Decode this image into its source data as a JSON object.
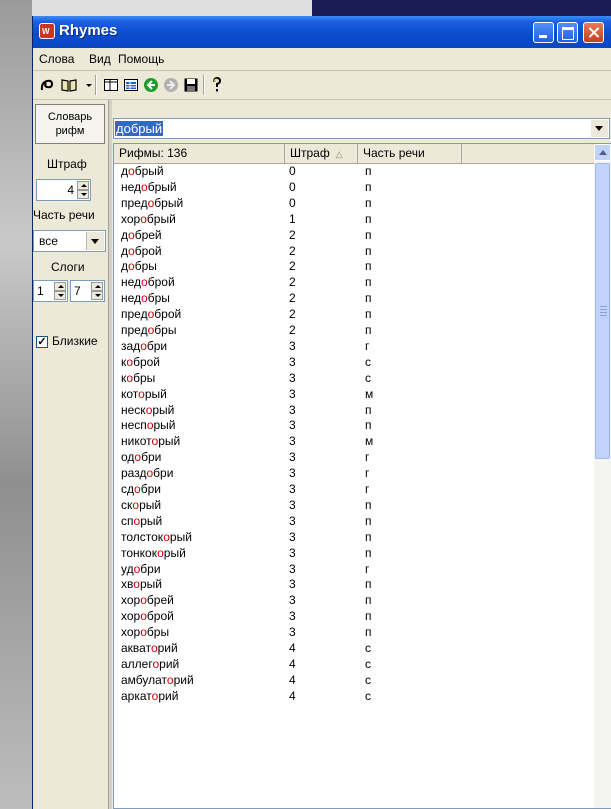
{
  "window": {
    "title": "Rhymes",
    "app_icon_text": "W"
  },
  "menu": {
    "items": [
      "Слова",
      "Вид",
      "Помощь"
    ]
  },
  "toolbar": {
    "icons": [
      "cursor-icon",
      "book-icon",
      "dropdown-arrow-icon",
      "layout-icon",
      "table-icon",
      "go-forward-icon",
      "go-disabled-icon",
      "save-icon",
      "help-icon"
    ]
  },
  "left_panel": {
    "dict_button": "Словарь рифм",
    "penalty_label": "Штраф",
    "penalty_value": "4",
    "pos_label": "Часть речи",
    "pos_value": "все",
    "syllables_label": "Слоги",
    "syl_from": "1",
    "syl_to": "7",
    "close_label": "Близкие",
    "close_checked": true
  },
  "search": {
    "word": "добрый"
  },
  "list": {
    "headers": {
      "rhymes": "Рифмы: 136",
      "penalty": "Штраф",
      "pos": "Часть речи"
    },
    "rows": [
      {
        "pre": "д",
        "hl": "о",
        "post": "брый",
        "penalty": "0",
        "pos": "п"
      },
      {
        "pre": "нед",
        "hl": "о",
        "post": "брый",
        "penalty": "0",
        "pos": "п"
      },
      {
        "pre": "пред",
        "hl": "о",
        "post": "брый",
        "penalty": "0",
        "pos": "п"
      },
      {
        "pre": "хор",
        "hl": "о",
        "post": "брый",
        "penalty": "1",
        "pos": "п"
      },
      {
        "pre": "д",
        "hl": "о",
        "post": "брей",
        "penalty": "2",
        "pos": "п"
      },
      {
        "pre": "д",
        "hl": "о",
        "post": "брой",
        "penalty": "2",
        "pos": "п"
      },
      {
        "pre": "д",
        "hl": "о",
        "post": "бры",
        "penalty": "2",
        "pos": "п"
      },
      {
        "pre": "нед",
        "hl": "о",
        "post": "брой",
        "penalty": "2",
        "pos": "п"
      },
      {
        "pre": "нед",
        "hl": "о",
        "post": "бры",
        "penalty": "2",
        "pos": "п"
      },
      {
        "pre": "пред",
        "hl": "о",
        "post": "брой",
        "penalty": "2",
        "pos": "п"
      },
      {
        "pre": "пред",
        "hl": "о",
        "post": "бры",
        "penalty": "2",
        "pos": "п"
      },
      {
        "pre": "зад",
        "hl": "о",
        "post": "бри",
        "penalty": "3",
        "pos": "г"
      },
      {
        "pre": "к",
        "hl": "о",
        "post": "брой",
        "penalty": "3",
        "pos": "с"
      },
      {
        "pre": "к",
        "hl": "о",
        "post": "бры",
        "penalty": "3",
        "pos": "с"
      },
      {
        "pre": "кот",
        "hl": "о",
        "post": "рый",
        "penalty": "3",
        "pos": "м"
      },
      {
        "pre": "неск",
        "hl": "о",
        "post": "рый",
        "penalty": "3",
        "pos": "п"
      },
      {
        "pre": "несп",
        "hl": "о",
        "post": "рый",
        "penalty": "3",
        "pos": "п"
      },
      {
        "pre": "никот",
        "hl": "о",
        "post": "рый",
        "penalty": "3",
        "pos": "м"
      },
      {
        "pre": "од",
        "hl": "о",
        "post": "бри",
        "penalty": "3",
        "pos": "г"
      },
      {
        "pre": "разд",
        "hl": "о",
        "post": "бри",
        "penalty": "3",
        "pos": "г"
      },
      {
        "pre": "сд",
        "hl": "о",
        "post": "бри",
        "penalty": "3",
        "pos": "г"
      },
      {
        "pre": "ск",
        "hl": "о",
        "post": "рый",
        "penalty": "3",
        "pos": "п"
      },
      {
        "pre": "сп",
        "hl": "о",
        "post": "рый",
        "penalty": "3",
        "pos": "п"
      },
      {
        "pre": "толсток",
        "hl": "о",
        "post": "рый",
        "penalty": "3",
        "pos": "п"
      },
      {
        "pre": "тонкок",
        "hl": "о",
        "post": "рый",
        "penalty": "3",
        "pos": "п"
      },
      {
        "pre": "уд",
        "hl": "о",
        "post": "бри",
        "penalty": "3",
        "pos": "г"
      },
      {
        "pre": "хв",
        "hl": "о",
        "post": "рый",
        "penalty": "3",
        "pos": "п"
      },
      {
        "pre": "хор",
        "hl": "о",
        "post": "брей",
        "penalty": "3",
        "pos": "п"
      },
      {
        "pre": "хор",
        "hl": "о",
        "post": "брой",
        "penalty": "3",
        "pos": "п"
      },
      {
        "pre": "хор",
        "hl": "о",
        "post": "бры",
        "penalty": "3",
        "pos": "п"
      },
      {
        "pre": "акват",
        "hl": "о",
        "post": "рий",
        "penalty": "4",
        "pos": "с"
      },
      {
        "pre": "аллег",
        "hl": "о",
        "post": "рий",
        "penalty": "4",
        "pos": "с"
      },
      {
        "pre": "амбулат",
        "hl": "о",
        "post": "рий",
        "penalty": "4",
        "pos": "с"
      },
      {
        "pre": "аркат",
        "hl": "о",
        "post": "рий",
        "penalty": "4",
        "pos": "с"
      }
    ]
  },
  "colors": {
    "titlebar": "#0a4ccf",
    "stress_highlight": "#d00000",
    "selection": "#316ac5"
  }
}
